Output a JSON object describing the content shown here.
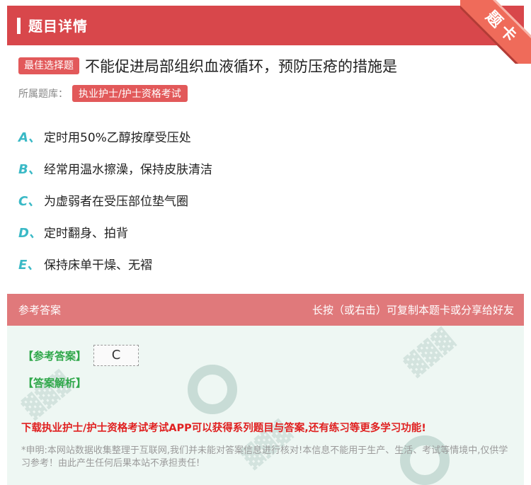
{
  "header": {
    "title": "题目详情"
  },
  "corner_ribbon": {
    "label": "题卡"
  },
  "question": {
    "type_tag": "最佳选择题",
    "text": "不能促进局部组织血液循环，预防压疮的措施是",
    "bank_label": "所属题库：",
    "bank_tag": "执业护士/护士资格考试"
  },
  "options": [
    {
      "letter": "A、",
      "text": "定时用50%乙醇按摩受压处"
    },
    {
      "letter": "B、",
      "text": "经常用温水擦澡，保持皮肤清洁"
    },
    {
      "letter": "C、",
      "text": "为虚弱者在受压部位垫气圈"
    },
    {
      "letter": "D、",
      "text": "定时翻身、拍背"
    },
    {
      "letter": "E、",
      "text": "保持床单干燥、无褶"
    }
  ],
  "answer_section": {
    "header_left": "参考答案",
    "header_right": "长按（或右击）可复制本题卡或分享给好友",
    "ref_label": "【参考答案】",
    "ref_value": "C",
    "analysis_label": "【答案解析】",
    "promo": "下载执业护士/护士资格考试考试APP可以获得系列题目与答案,还有练习等更多学习功能!",
    "disclaimer": "*申明:本网站数据收集整理于互联网,我们并未能对答案信息进行核对!本信息不能用于生产、生活、考试等情境中,仅供学习参考！由此产生任何后果本站不承担责任!"
  },
  "colors": {
    "header_red": "#d8474b",
    "tag_red": "#e2595a",
    "option_letter": "#3ab9c6",
    "answer_header": "#e0797b",
    "answer_bg": "#eef7f3",
    "answer_green": "#2fa74a",
    "promo_red": "#e02020"
  }
}
